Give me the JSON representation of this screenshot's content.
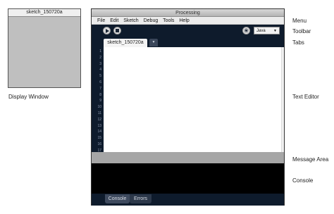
{
  "display_window": {
    "title": "sketch_150720a",
    "caption": "Display Window"
  },
  "pde": {
    "title": "Processing",
    "menu": [
      "File",
      "Edit",
      "Sketch",
      "Debug",
      "Tools",
      "Help"
    ],
    "mode": "Java",
    "tab_name": "sketch_150720a",
    "line_numbers": [
      "1",
      "2",
      "3",
      "4",
      "5",
      "6",
      "7",
      "8",
      "9",
      "10",
      "11",
      "12",
      "13",
      "14",
      "15",
      "16",
      "17"
    ],
    "console_tabs": [
      "Console",
      "Errors"
    ]
  },
  "labels": {
    "menu": "Menu",
    "toolbar": "Toolbar",
    "tabs": "Tabs",
    "text_editor": "Text Editor",
    "message_area": "Message Area",
    "console": "Console"
  },
  "icons": {
    "run": "play-icon",
    "stop": "stop-icon",
    "debug": "butterfly-icon",
    "tab_menu": "chevron-down-icon",
    "mode_menu": "chevron-down-icon"
  },
  "colors": {
    "window_background": "#0e1b2c",
    "editor_background": "#ffffff",
    "message_area": "#a6a6a6",
    "console_background": "#000000",
    "display_background": "#bfbfbf"
  }
}
